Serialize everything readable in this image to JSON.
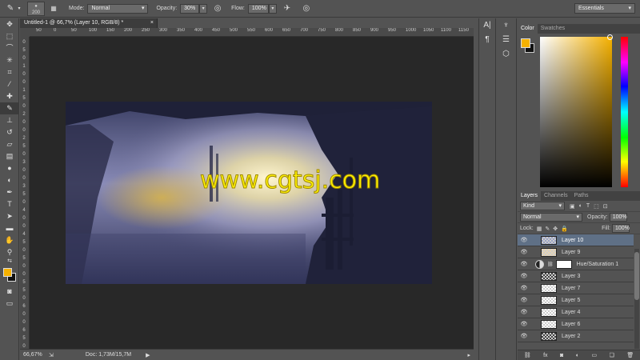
{
  "options_bar": {
    "brush_size": "200",
    "mode_label": "Mode:",
    "mode_value": "Normal",
    "opacity_label": "Opacity:",
    "opacity_value": "30%",
    "flow_label": "Flow:",
    "flow_value": "100%",
    "workspace": "Essentials"
  },
  "document": {
    "tab_title": "Untitled-1 @ 66,7% (Layer 10, RGB/8) *",
    "close_glyph": "×",
    "ruler_h": [
      "50",
      "0",
      "50",
      "100",
      "150",
      "200",
      "250",
      "300",
      "350",
      "400",
      "450",
      "500",
      "550",
      "600",
      "650",
      "700",
      "750",
      "800",
      "850",
      "900",
      "950",
      "1000",
      "1050",
      "1100",
      "1150"
    ],
    "ruler_v": [
      "0",
      "5",
      "0",
      "1",
      "0",
      "0",
      "1",
      "5",
      "0",
      "2",
      "0",
      "0",
      "2",
      "5",
      "0",
      "3",
      "0",
      "0",
      "3",
      "5",
      "0",
      "4",
      "0",
      "0",
      "4",
      "5",
      "0",
      "5",
      "0",
      "0",
      "5",
      "5",
      "0",
      "6",
      "0",
      "0",
      "6",
      "5",
      "0"
    ],
    "watermark": "www.cgtsj.com",
    "zoom": "66,67%",
    "doc_size": "Doc: 1,73M/15,7M"
  },
  "color_panel": {
    "tabs": [
      "Color",
      "Swatches"
    ],
    "foreground": "#f5b100",
    "background": "#111111"
  },
  "layers_panel": {
    "tabs": [
      "Layers",
      "Channels",
      "Paths"
    ],
    "filter_kind": "Kind",
    "blend_mode": "Normal",
    "opacity_label": "Opacity:",
    "opacity_value": "100%",
    "lock_label": "Lock:",
    "fill_label": "Fill:",
    "fill_value": "100%",
    "layers": [
      {
        "name": "Layer 10",
        "selected": true
      },
      {
        "name": "Layer 9"
      },
      {
        "name": "Hue/Saturation 1"
      },
      {
        "name": "Layer 3"
      },
      {
        "name": "Layer 7"
      },
      {
        "name": "Layer 5"
      },
      {
        "name": "Layer 4"
      },
      {
        "name": "Layer 6"
      },
      {
        "name": "Layer 2"
      }
    ]
  }
}
